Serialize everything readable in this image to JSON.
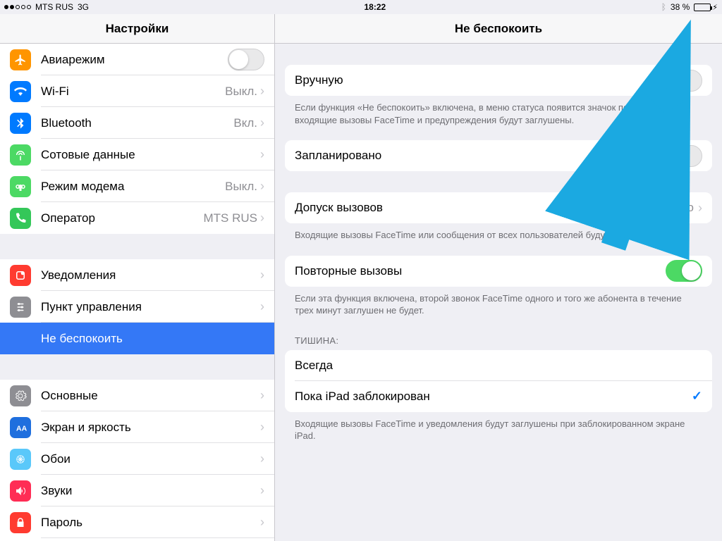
{
  "status": {
    "carrier": "MTS RUS",
    "network": "3G",
    "time": "18:22",
    "battery_pct": "38 %"
  },
  "titles": {
    "left": "Настройки",
    "right": "Не беспокоить"
  },
  "sidebar": {
    "airplane": "Авиарежим",
    "wifi": "Wi-Fi",
    "wifi_v": "Выкл.",
    "bt": "Bluetooth",
    "bt_v": "Вкл.",
    "cell": "Сотовые данные",
    "hotspot": "Режим модема",
    "hotspot_v": "Выкл.",
    "carrier": "Оператор",
    "carrier_v": "MTS RUS",
    "notif": "Уведомления",
    "cc": "Пункт управления",
    "dnd": "Не беспокоить",
    "general": "Основные",
    "display": "Экран и яркость",
    "wall": "Обои",
    "sounds": "Звуки",
    "pass": "Пароль"
  },
  "detail": {
    "manual": "Вручную",
    "manual_foot": "Если функция «Не беспокоить» включена, в меню статуса появится значок полумесяца, а входящие вызовы FaceTime и предупреждения будут заглушены.",
    "scheduled": "Запланировано",
    "allow": "Допуск вызовов",
    "allow_v": "Ни от кого",
    "allow_foot": "Входящие вызовы FaceTime или сообщения от всех пользователей будут заглушены.",
    "repeat": "Повторные вызовы",
    "repeat_foot": "Если эта функция включена, второй звонок FaceTime одного и того же абонента в течение трех минут заглушен не будет.",
    "silence_hdr": "Тишина:",
    "always": "Всегда",
    "locked": "Пока iPad заблокирован",
    "silence_foot": "Входящие вызовы FaceTime и уведомления будут заглушены при заблокированном экране iPad."
  }
}
